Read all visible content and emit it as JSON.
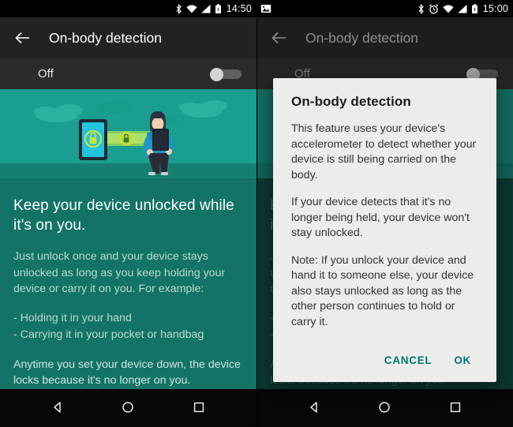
{
  "left_screen": {
    "statusbar": {
      "icons": [
        "bluetooth-icon",
        "wifi-icon",
        "cell-signal-icon",
        "battery-charging-icon"
      ],
      "time": "14:50"
    },
    "appbar": {
      "back_icon": "back-arrow-icon",
      "title": "On-body detection"
    },
    "toggle_row": {
      "label": "Off",
      "state": "off"
    },
    "illustration": {
      "name": "on-body-detection-illustration",
      "description": "Person holding a tablet with a lock, beam linking to a phone",
      "colors": {
        "sky": "#1a9e8f",
        "ground": "#137367",
        "cloud": "#2fb0a0",
        "phone_body": "#1c2b33",
        "phone_screen": "#25c6e0",
        "lock": "#c6e03a",
        "beam": "#9fd64a",
        "person_shirt": "#2196c9",
        "person_pants": "#2b2b38",
        "person_skin": "#e8c9a8"
      }
    },
    "body": {
      "headline": "Keep your device unlocked while it's on you.",
      "paragraph_1": "Just unlock once and your device stays unlocked as long as you keep holding your device or carry it on you. For example:",
      "bullet_1": "- Holding it in your hand",
      "bullet_2": "- Carrying it in your pocket or handbag",
      "paragraph_2": "Anytime you set your device down, the device locks because it's no longer on you."
    },
    "navbar": {
      "back": "nav-back-icon",
      "home": "nav-home-icon",
      "recents": "nav-recents-icon"
    }
  },
  "right_screen": {
    "statusbar": {
      "left_icons": [
        "screenshot-icon"
      ],
      "icons": [
        "bluetooth-icon",
        "alarm-clock-icon",
        "wifi-icon",
        "cell-signal-icon",
        "battery-charging-icon"
      ],
      "time": "15:00"
    },
    "appbar": {
      "back_icon": "back-arrow-icon",
      "title": "On-body detection"
    },
    "toggle_row": {
      "label": "Off",
      "state": "off"
    },
    "body": {
      "headline": "Keep your device unlocked while it's on you.",
      "paragraph_1": "Just unlock once and your device stays unlocked as long as you keep holding your device or carry it on you. For example:",
      "bullet_1": "- Holding it in your hand",
      "bullet_2": "- Carrying it in your pocket or handbag",
      "paragraph_2": "Anytime you set your device down, the device locks because it's no longer on you."
    },
    "dialog": {
      "title": "On-body detection",
      "paragraph_1": "This feature uses your device's accelerometer to detect whether your device is still being carried on the body.",
      "paragraph_2": "If your device detects that it's no longer being held, your device won't stay unlocked.",
      "paragraph_3": "Note: If you unlock your device and hand it to someone else, your device also stays unlocked as long as the other person continues to hold or carry it.",
      "cancel_label": "CANCEL",
      "ok_label": "OK",
      "accent_color": "#00796b"
    },
    "navbar": {
      "back": "nav-back-icon",
      "home": "nav-home-icon",
      "recents": "nav-recents-icon"
    }
  }
}
